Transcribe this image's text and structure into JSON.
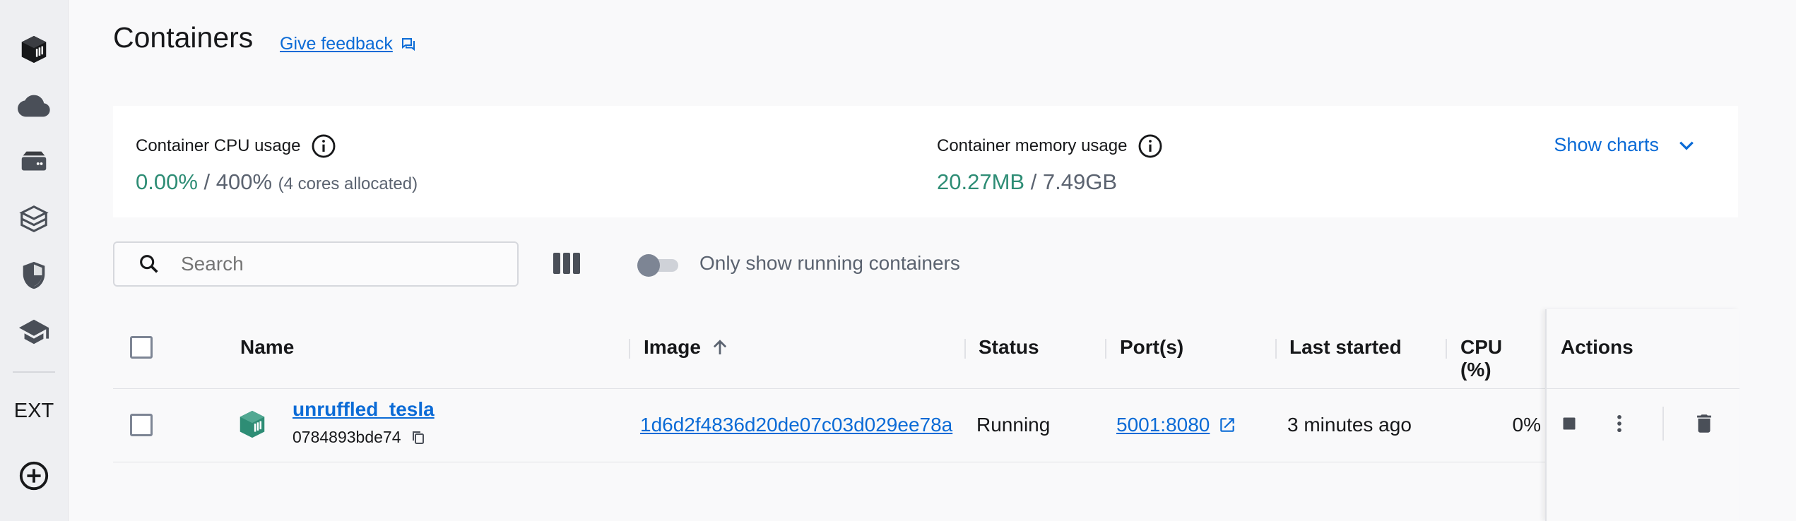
{
  "sidebar": {
    "items": [
      {
        "icon": "containers-icon"
      },
      {
        "icon": "cloud-icon"
      },
      {
        "icon": "volumes-icon"
      },
      {
        "icon": "builds-icon"
      },
      {
        "icon": "security-shield-icon"
      },
      {
        "icon": "learning-center-icon"
      }
    ],
    "ext_label": "EXT",
    "add_icon": "add-extension-icon"
  },
  "header": {
    "title": "Containers",
    "feedback_label": "Give feedback"
  },
  "stats": {
    "cpu_label": "Container CPU usage",
    "cpu_used": "0.00%",
    "cpu_total": " / 400%",
    "cpu_note": "(4 cores allocated)",
    "mem_label": "Container memory usage",
    "mem_used": "20.27MB",
    "mem_total": " / 7.49GB",
    "show_charts_label": "Show charts"
  },
  "toolbar": {
    "search_placeholder": "Search",
    "toggle_label": "Only show running containers",
    "toggle_on": false
  },
  "table": {
    "columns": [
      "Name",
      "Image",
      "Status",
      "Port(s)",
      "Last started",
      "CPU (%)",
      "Actions"
    ],
    "sort": {
      "column": "Image",
      "direction": "ascending"
    },
    "rows": [
      {
        "name": "unruffled_tesla",
        "id": "0784893bde74",
        "image": "1d6d2f4836d20de07c03d029ee78a",
        "status": "Running",
        "ports": "5001:8080",
        "last_started": "3 minutes ago",
        "cpu": "0%"
      }
    ]
  },
  "colors": {
    "accent_link": "#0b6bd6",
    "running_green": "#2e8d75"
  }
}
